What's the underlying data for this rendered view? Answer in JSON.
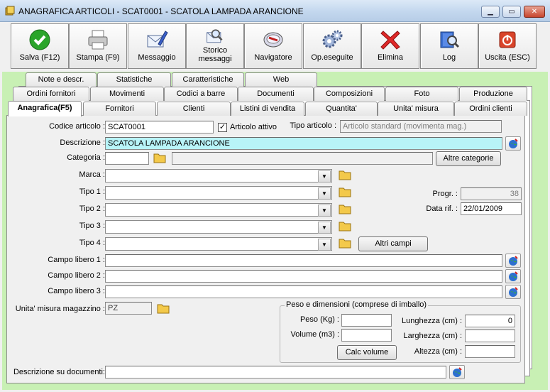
{
  "window": {
    "title": "ANAGRAFICA ARTICOLI - SCAT0001 - SCATOLA LAMPADA ARANCIONE"
  },
  "toolbar": {
    "save": "Salva (F12)",
    "print": "Stampa (F9)",
    "message": "Messaggio",
    "history": "Storico\nmessaggi",
    "navigator": "Navigatore",
    "operations": "Op.eseguite",
    "delete": "Elimina",
    "log": "Log",
    "exit": "Uscita (ESC)"
  },
  "tabs": {
    "row1": [
      "Note e descr.",
      "Statistiche",
      "Caratteristiche",
      "Web"
    ],
    "row2": [
      "Ordini fornitori",
      "Movimenti",
      "Codici a barre",
      "Documenti",
      "Composizioni",
      "Foto",
      "Produzione"
    ],
    "row3": [
      "Anagrafica(F5)",
      "Fornitori",
      "Clienti",
      "Listini di vendita",
      "Quantita'",
      "Unita' misura",
      "Ordini clienti"
    ]
  },
  "form": {
    "code_label": "Codice articolo :",
    "code_value": "SCAT0001",
    "active_label": "Articolo attivo",
    "active_checked": true,
    "type_label": "Tipo articolo :",
    "type_value": "Articolo standard (movimenta mag.)",
    "description_label": "Descrizione :",
    "description_value": "SCATOLA LAMPADA ARANCIONE",
    "category_label": "Categoria :",
    "category_value": "",
    "other_categories": "Altre categorie",
    "brand_label": "Marca :",
    "type1_label": "Tipo 1 :",
    "type2_label": "Tipo 2 :",
    "type3_label": "Tipo 3 :",
    "type4_label": "Tipo 4 :",
    "other_fields": "Altri campi",
    "prog_label": "Progr. :",
    "prog_value": "38",
    "date_label": "Data rif. :",
    "date_value": "22/01/2009",
    "free1_label": "Campo libero 1 :",
    "free2_label": "Campo libero 2 :",
    "free3_label": "Campo libero 3 :",
    "uom_label": "Unita' misura magazzino :",
    "uom_value": "PZ",
    "doc_desc_label": "Descrizione su documenti:"
  },
  "dimensions": {
    "title": "Peso e dimensioni (comprese di imballo)",
    "weight_label": "Peso (Kg) :",
    "volume_label": "Volume (m3) :",
    "length_label": "Lunghezza (cm) :",
    "length_value": "0",
    "width_label": "Larghezza (cm) :",
    "height_label": "Altezza (cm) :",
    "calc_button": "Calc volume"
  }
}
